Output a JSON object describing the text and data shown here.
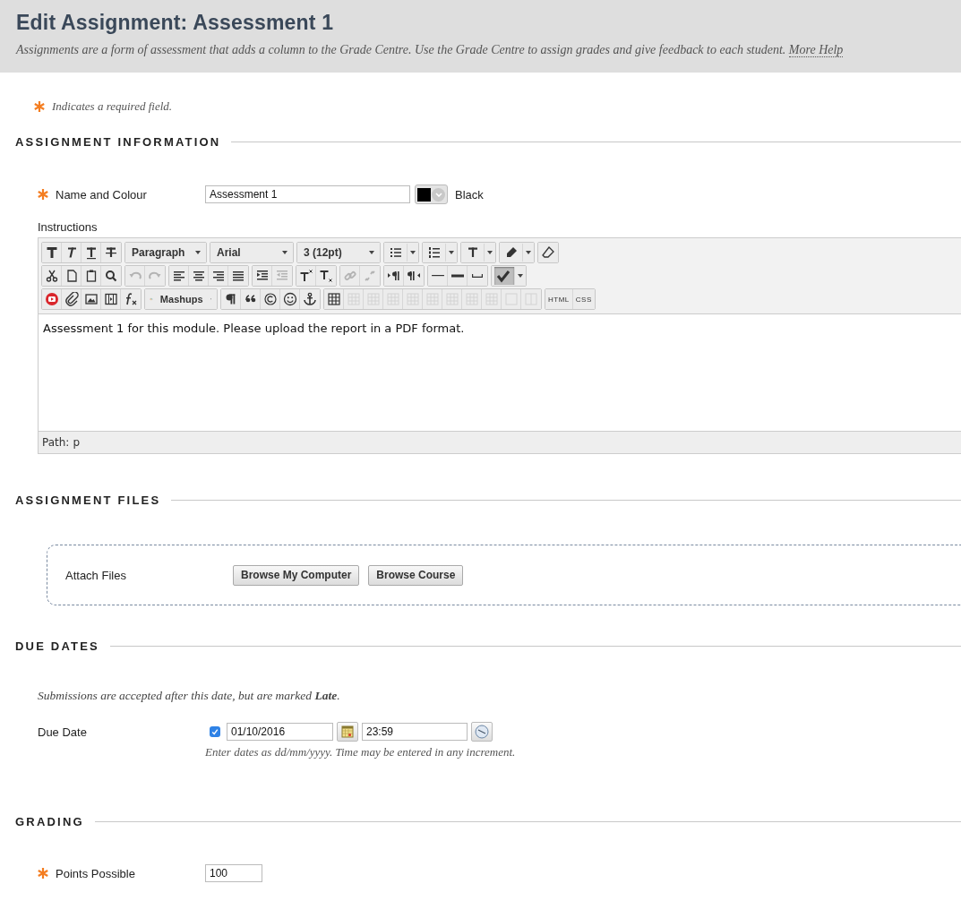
{
  "page": {
    "title": "Edit Assignment: Assessment 1",
    "description": "Assignments are a form of assessment that adds a column to the Grade Centre. Use the Grade Centre to assign grades and give feedback to each student.",
    "help_link": "More Help"
  },
  "required_note": "Indicates a required field.",
  "assignment_information": {
    "heading": "ASSIGNMENT INFORMATION",
    "name_field": {
      "label": "Name and Colour",
      "required": true,
      "value": "Assessment 1",
      "colour_label": "Black"
    },
    "instructions": {
      "label": "Instructions",
      "toolbar": [
        [
          [
            {
              "kind": "icon",
              "disabled": false,
              "pressed": false
            },
            {
              "kind": "icon",
              "disabled": false,
              "pressed": false
            },
            {
              "kind": "icon",
              "disabled": false,
              "pressed": false
            },
            {
              "kind": "icon",
              "disabled": false,
              "pressed": false
            }
          ],
          [
            {
              "kind": "dropdown",
              "label": "Paragraph"
            }
          ],
          [
            {
              "kind": "dropdown",
              "label": "Arial"
            }
          ],
          [
            {
              "kind": "dropdown",
              "label": "3 (12pt)"
            }
          ],
          [
            {
              "kind": "split",
              "disabled": false,
              "pressed": false
            }
          ],
          [
            {
              "kind": "split",
              "disabled": false,
              "pressed": false
            }
          ],
          [
            {
              "kind": "split",
              "disabled": false,
              "pressed": false
            }
          ],
          [
            {
              "kind": "split",
              "disabled": false,
              "pressed": false
            }
          ],
          [
            {
              "kind": "icon",
              "disabled": false,
              "pressed": false
            }
          ]
        ],
        [
          [
            {
              "kind": "icon",
              "disabled": false,
              "pressed": false
            },
            {
              "kind": "icon",
              "disabled": false,
              "pressed": false
            },
            {
              "kind": "icon",
              "disabled": false,
              "pressed": false
            },
            {
              "kind": "icon",
              "disabled": false,
              "pressed": false
            }
          ],
          [
            {
              "kind": "icon",
              "disabled": true,
              "pressed": false
            },
            {
              "kind": "icon",
              "disabled": true,
              "pressed": false
            }
          ],
          [
            {
              "kind": "icon",
              "disabled": false,
              "pressed": false
            },
            {
              "kind": "icon",
              "disabled": false,
              "pressed": false
            },
            {
              "kind": "icon",
              "disabled": false,
              "pressed": false
            },
            {
              "kind": "icon",
              "disabled": false,
              "pressed": false
            }
          ],
          [
            {
              "kind": "icon",
              "disabled": false,
              "pressed": false
            },
            {
              "kind": "icon",
              "disabled": true,
              "pressed": false
            }
          ],
          [
            {
              "kind": "icon",
              "disabled": false,
              "pressed": false
            },
            {
              "kind": "icon",
              "disabled": false,
              "pressed": false
            }
          ],
          [
            {
              "kind": "icon",
              "disabled": true,
              "pressed": false
            },
            {
              "kind": "icon",
              "disabled": true,
              "pressed": false
            }
          ],
          [
            {
              "kind": "icon",
              "disabled": false,
              "pressed": false
            },
            {
              "kind": "icon",
              "disabled": false,
              "pressed": false
            }
          ],
          [
            {
              "kind": "icon",
              "disabled": false,
              "pressed": false
            },
            {
              "kind": "icon",
              "disabled": false,
              "pressed": false
            },
            {
              "kind": "icon",
              "disabled": false,
              "pressed": false
            }
          ],
          [
            {
              "kind": "split",
              "disabled": false,
              "pressed": true
            }
          ]
        ],
        [
          [
            {
              "kind": "icon",
              "disabled": false,
              "pressed": false
            },
            {
              "kind": "icon",
              "disabled": false,
              "pressed": false
            },
            {
              "kind": "icon",
              "disabled": false,
              "pressed": false
            },
            {
              "kind": "icon",
              "disabled": false,
              "pressed": false
            },
            {
              "kind": "icon",
              "disabled": false,
              "pressed": false
            }
          ],
          [
            {
              "kind": "icon-dropdown",
              "label": "Mashups"
            }
          ],
          [
            {
              "kind": "icon",
              "disabled": false,
              "pressed": false
            },
            {
              "kind": "icon",
              "disabled": false,
              "pressed": false
            },
            {
              "kind": "icon",
              "disabled": false,
              "pressed": false
            },
            {
              "kind": "icon",
              "disabled": false,
              "pressed": false
            },
            {
              "kind": "icon",
              "disabled": false,
              "pressed": false
            }
          ],
          [
            {
              "kind": "icon",
              "disabled": false,
              "pressed": false
            },
            {
              "kind": "icon",
              "disabled": true,
              "pressed": false
            },
            {
              "kind": "icon",
              "disabled": true,
              "pressed": false
            },
            {
              "kind": "icon",
              "disabled": true,
              "pressed": false
            },
            {
              "kind": "icon",
              "disabled": true,
              "pressed": false
            },
            {
              "kind": "icon",
              "disabled": true,
              "pressed": false
            },
            {
              "kind": "icon",
              "disabled": true,
              "pressed": false
            },
            {
              "kind": "icon",
              "disabled": true,
              "pressed": false
            },
            {
              "kind": "icon",
              "disabled": true,
              "pressed": false
            },
            {
              "kind": "icon",
              "disabled": true,
              "pressed": false
            },
            {
              "kind": "icon",
              "disabled": true,
              "pressed": false
            }
          ],
          [
            {
              "kind": "text",
              "label": "HTML"
            },
            {
              "kind": "text",
              "label": "CSS"
            }
          ]
        ]
      ],
      "content": "Assessment 1 for this module. Please upload the report in a PDF format.",
      "path_label": "Path:",
      "path": "p"
    }
  },
  "assignment_files": {
    "heading": "ASSIGNMENT FILES",
    "attach_label": "Attach Files",
    "buttons": [
      "Browse My Computer",
      "Browse Course"
    ]
  },
  "due_dates": {
    "heading": "DUE DATES",
    "note": "Submissions are accepted after this date, but are marked **Late**.",
    "due_date": {
      "label": "Due Date",
      "enabled": true,
      "date": "01/10/2016",
      "time": "23:59",
      "hint": "Enter dates as dd/mm/yyyy. Time may be entered in any increment."
    }
  },
  "grading": {
    "heading": "GRADING",
    "points": {
      "label": "Points Possible",
      "required": true,
      "value": "100"
    }
  }
}
